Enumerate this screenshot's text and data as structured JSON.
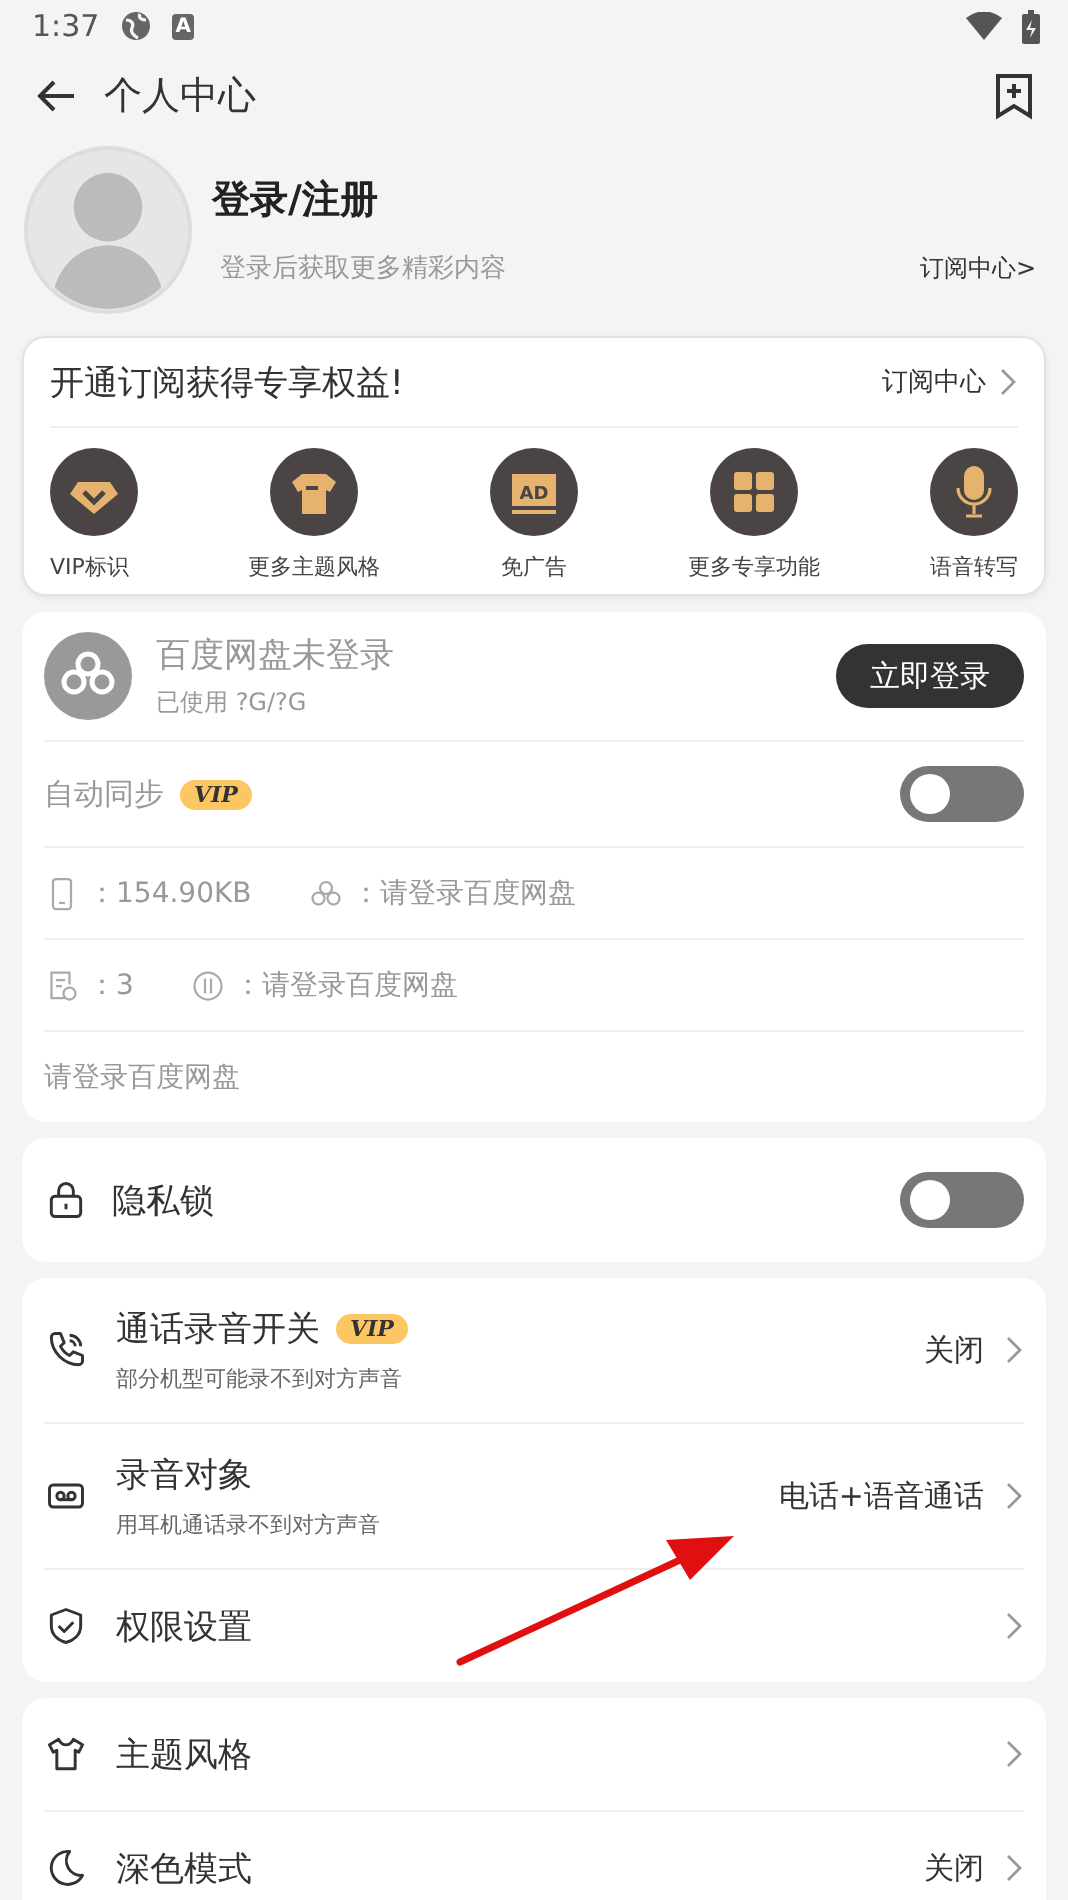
{
  "status_bar": {
    "time": "1:37",
    "badge": "A"
  },
  "header": {
    "title": "个人中心"
  },
  "profile": {
    "name": "登录/注册",
    "subtitle": "登录后获取更多精彩内容",
    "link": "订阅中心>"
  },
  "subscription": {
    "title": "开通订阅获得专享权益!",
    "link": "订阅中心",
    "benefits": [
      {
        "kind": "vip",
        "label": "VIP标识"
      },
      {
        "kind": "shirt",
        "label": "更多主题风格"
      },
      {
        "kind": "ad",
        "label": "免广告",
        "icon_text": "AD"
      },
      {
        "kind": "grid",
        "label": "更多专享功能"
      },
      {
        "kind": "mic",
        "label": "语音转写"
      }
    ]
  },
  "cloud": {
    "name": "百度网盘未登录",
    "usage": "已使用 ?G/?G",
    "login_button": "立即登录",
    "sync": {
      "label": "自动同步",
      "badge": "VIP",
      "on": false
    },
    "stats": [
      [
        {
          "kind": "phone",
          "text": "：154.90KB"
        },
        {
          "kind": "cloud",
          "text": "：请登录百度网盘"
        }
      ],
      [
        {
          "kind": "file",
          "text": "：3"
        },
        {
          "kind": "transfer",
          "text": "：请登录百度网盘"
        }
      ]
    ],
    "note": "请登录百度网盘"
  },
  "privacy": {
    "label": "隐私锁",
    "on": false
  },
  "call_settings": [
    {
      "kind": "phone",
      "title": "通话录音开关",
      "badge": "VIP",
      "subtitle": "部分机型可能录不到对方声音",
      "value": "关闭"
    },
    {
      "kind": "voicemail",
      "title": "录音对象",
      "subtitle": "用耳机通话录不到对方声音",
      "value": "电话+语音通话"
    },
    {
      "kind": "shield",
      "title": "权限设置"
    }
  ],
  "appearance": [
    {
      "kind": "shirt",
      "title": "主题风格"
    },
    {
      "kind": "moon",
      "title": "深色模式",
      "value": "关闭"
    }
  ]
}
